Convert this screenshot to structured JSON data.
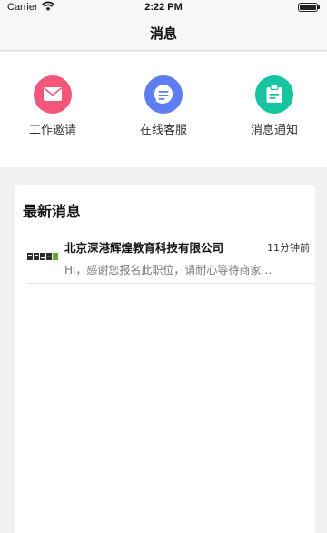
{
  "status_bar": {
    "carrier": "Carrier",
    "time": "2:22 PM",
    "icons": [
      "wifi-icon",
      "battery-icon"
    ]
  },
  "nav": {
    "title": "消息"
  },
  "shortcuts": [
    {
      "label": "工作邀请",
      "icon": "envelope-icon",
      "color": "#f2577a"
    },
    {
      "label": "在线客服",
      "icon": "chat-bubble-icon",
      "color": "#5c7ef0"
    },
    {
      "label": "消息通知",
      "icon": "clipboard-icon",
      "color": "#16c5a0"
    }
  ],
  "news": {
    "title": "最新消息",
    "items": [
      {
        "company": "北京深港辉煌教育科技有限公司",
        "time": "11分钟前",
        "preview": "Hi，感谢您报名此职位，请耐心等待商家…",
        "avatar_icon": "company-logo-icon"
      }
    ]
  }
}
